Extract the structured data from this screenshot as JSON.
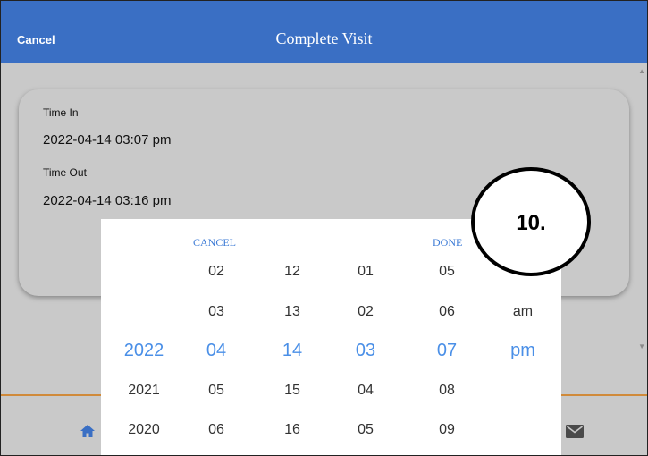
{
  "header": {
    "cancel_label": "Cancel",
    "title": "Complete Visit"
  },
  "visit": {
    "time_in_label": "Time In",
    "time_in_value": "2022-04-14 03:07 pm",
    "time_out_label": "Time Out",
    "time_out_value": "2022-04-14 03:16 pm"
  },
  "picker": {
    "cancel_label": "CANCEL",
    "done_label": "DONE",
    "columns": {
      "year": [
        "",
        "",
        "2022",
        "2021",
        "2020"
      ],
      "month": [
        "02",
        "03",
        "04",
        "05",
        "06"
      ],
      "day": [
        "12",
        "13",
        "14",
        "15",
        "16"
      ],
      "hour": [
        "01",
        "02",
        "03",
        "04",
        "05"
      ],
      "minute": [
        "05",
        "06",
        "07",
        "08",
        "09"
      ],
      "ampm": [
        "",
        "am",
        "pm",
        "",
        ""
      ]
    }
  },
  "callout": {
    "text": "10."
  },
  "icons": {
    "home": "home-icon",
    "mail": "mail-icon"
  },
  "colors": {
    "header": "#3a6fc4",
    "selected": "#4a8fe7",
    "accent_line": "#d08a3a"
  }
}
